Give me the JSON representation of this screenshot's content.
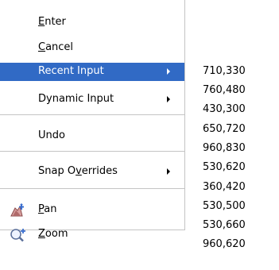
{
  "context_menu": {
    "enter": {
      "pre": "",
      "key": "E",
      "post": "nter"
    },
    "cancel": {
      "pre": "",
      "key": "C",
      "post": "ancel"
    },
    "recent_input": {
      "label": "Recent Input"
    },
    "dynamic_input": {
      "label": "Dynamic Input"
    },
    "undo": {
      "label": "Undo"
    },
    "snap_overrides": {
      "pre": "Snap O",
      "key": "v",
      "post": "errides"
    },
    "pan": {
      "pre": "",
      "key": "P",
      "post": "an",
      "icon": "pan-icon"
    },
    "zoom": {
      "pre": "",
      "key": "Z",
      "post": "oom",
      "icon": "zoom-icon"
    }
  },
  "submenu": {
    "items": [
      "710,330",
      "760,480",
      "430,300",
      "650,720",
      "960,830",
      "530,620",
      "360,420",
      "530,500",
      "530,660",
      "960,620"
    ]
  },
  "colors": {
    "highlight": "#316ac5",
    "highlight_text": "#ffffff",
    "separator": "#c4c4c4"
  }
}
